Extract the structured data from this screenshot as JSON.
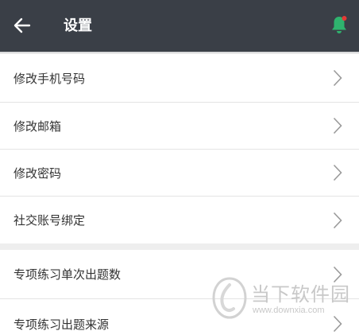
{
  "header": {
    "title": "设置",
    "back_icon": "arrow-left-icon",
    "bell_icon": "bell-icon",
    "bell_color": "#2fb36e",
    "badge_color": "#e53935",
    "background": "#3a3f47"
  },
  "groups": [
    {
      "items": [
        {
          "label": "修改手机号码"
        },
        {
          "label": "修改邮箱"
        },
        {
          "label": "修改密码"
        },
        {
          "label": "社交账号绑定"
        }
      ]
    },
    {
      "items": [
        {
          "label": "专项练习单次出题数"
        },
        {
          "label": "专项练习出题来源"
        }
      ]
    }
  ],
  "watermark": {
    "name": "当下软件园",
    "url": "www.downxia.com"
  }
}
